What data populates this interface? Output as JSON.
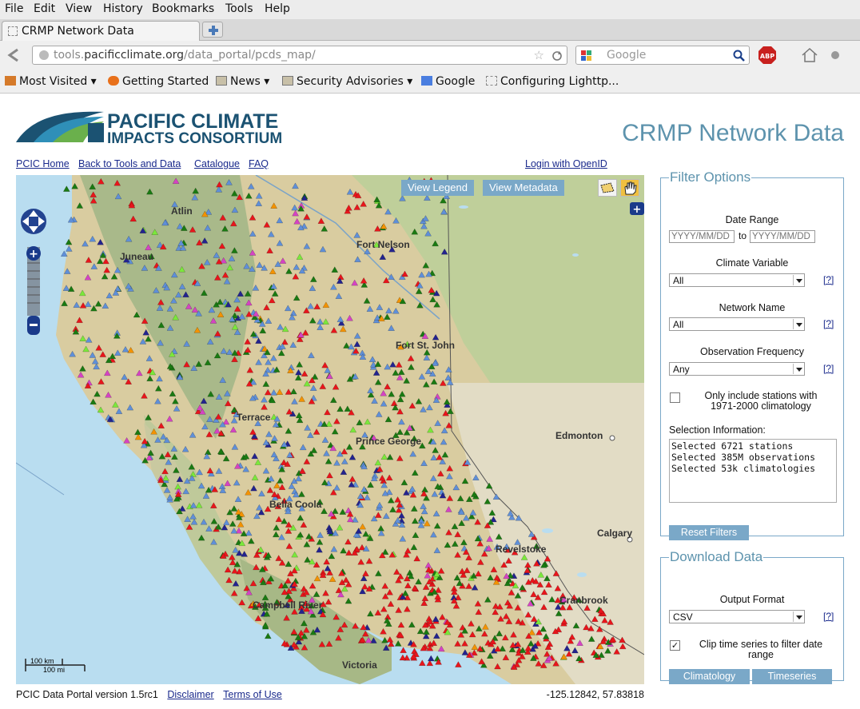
{
  "menu": [
    "File",
    "Edit",
    "View",
    "History",
    "Bookmarks",
    "Tools",
    "Help"
  ],
  "tab": {
    "title": "CRMP Network Data"
  },
  "url": {
    "host_prefix": "tools.",
    "host_main": "pacificclimate.org",
    "path": "/data_portal/pcds_map/"
  },
  "search": {
    "placeholder": "Google"
  },
  "bookmarks": [
    "Most Visited",
    "Getting Started",
    "News",
    "Security Advisories",
    "Google",
    "Configuring Lighttp..."
  ],
  "page": {
    "logo_line1": "PACIFIC CLIMATE",
    "logo_line2": "IMPACTS CONSORTIUM",
    "title": "CRMP Network Data",
    "nav": [
      "PCIC Home",
      "Back to Tools and Data",
      "Catalogue",
      "FAQ"
    ],
    "login": "Login with OpenID"
  },
  "map": {
    "view_legend": "View Legend",
    "view_metadata": "View Metadata",
    "places": [
      "Atlin",
      "Juneau",
      "Fort Nelson",
      "Fort St. John",
      "Terrace",
      "Prince George",
      "Edmonton",
      "Bella Coola",
      "Calgary",
      "Campbell River",
      "Victoria",
      "Cranbrook",
      "Revelstoke"
    ],
    "scale_km": "100 km",
    "scale_mi": "100 mi",
    "station_colors": [
      "#e8151b",
      "#1a7a12",
      "#5f8fd8",
      "#23238e",
      "#d543c3",
      "#7be83b",
      "#f39200"
    ]
  },
  "filter": {
    "legend": "Filter Options",
    "date_range_label": "Date Range",
    "date_from_placeholder": "YYYY/MM/DD",
    "date_to_label": "to",
    "date_to_placeholder": "YYYY/MM/DD",
    "climate_variable_label": "Climate Variable",
    "climate_variable_value": "All",
    "network_name_label": "Network Name",
    "network_name_value": "All",
    "obs_freq_label": "Observation Frequency",
    "obs_freq_value": "Any",
    "help": "[?]",
    "only_include_label": "Only include stations with 1971-2000 climatology",
    "only_include_checked": false,
    "selection_info_label": "Selection Information:",
    "selection_info_text": "Selected 6721 stations\nSelected 385M observations\nSelected 53k climatologies",
    "reset_button": "Reset Filters"
  },
  "download": {
    "legend": "Download Data",
    "output_format_label": "Output Format",
    "output_format_value": "CSV",
    "help": "[?]",
    "clip_label": "Clip time series to filter date range",
    "clip_checked": true,
    "climatology_button": "Climatology",
    "timeseries_button": "Timeseries"
  },
  "footer": {
    "version": "PCIC Data Portal version 1.5rc1",
    "disclaimer": "Disclaimer",
    "terms": "Terms of Use",
    "coords": "-125.12842, 57.83818"
  }
}
